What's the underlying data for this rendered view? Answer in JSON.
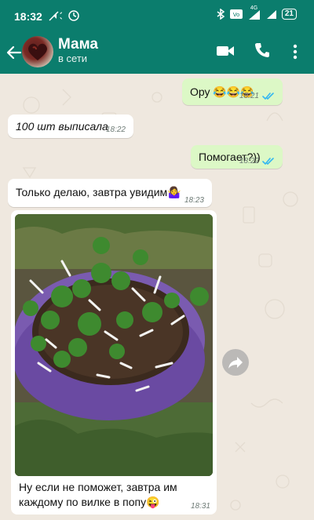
{
  "status_bar": {
    "time": "18:32",
    "network_label": "4G",
    "battery_level": "21"
  },
  "header": {
    "contact_name": "Мама",
    "contact_status": "в сети"
  },
  "messages": [
    {
      "direction": "out",
      "text": "Ору 😂😂😂",
      "time": "18:21",
      "read": true
    },
    {
      "direction": "in",
      "text": "100 шт выписала",
      "time": "18:22"
    },
    {
      "direction": "out",
      "text": "Помогает?))",
      "time": "18:22",
      "read": true
    },
    {
      "direction": "in",
      "text": "Только делаю, завтра увидим🤷‍♀️",
      "time": "18:23"
    },
    {
      "direction": "in",
      "type": "photo",
      "caption": "Ну если не поможет, завтра им каждому по вилке в попу😜",
      "time": "18:31"
    }
  ],
  "colors": {
    "header": "#0b7d6d",
    "outgoing_bubble": "#dcf8c6",
    "incoming_bubble": "#ffffff",
    "read_ticks": "#34b7f1",
    "chat_background": "#efe8df"
  },
  "icons": [
    "back-arrow-icon",
    "video-call-icon",
    "phone-icon",
    "more-vert-icon",
    "forward-icon"
  ]
}
